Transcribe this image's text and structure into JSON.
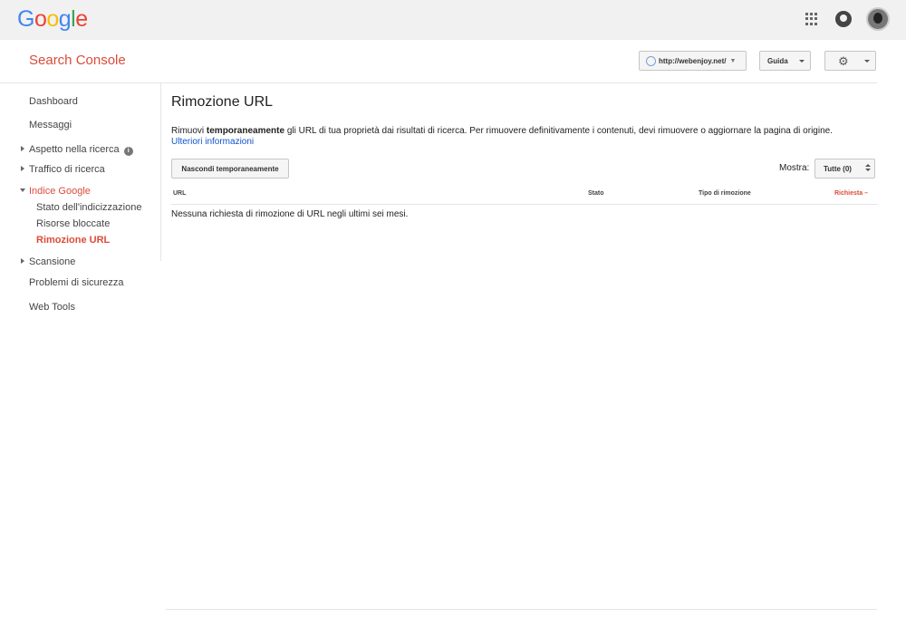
{
  "gbar": {
    "logo_letters": [
      {
        "ch": "G",
        "color": "#4285f4"
      },
      {
        "ch": "o",
        "color": "#ea4335"
      },
      {
        "ch": "o",
        "color": "#fbbc05"
      },
      {
        "ch": "g",
        "color": "#4285f4"
      },
      {
        "ch": "l",
        "color": "#34a853"
      },
      {
        "ch": "e",
        "color": "#ea4335"
      }
    ],
    "icons": [
      "apps-grid-icon",
      "notifications-icon",
      "user-avatar"
    ]
  },
  "header": {
    "title": "Search Console",
    "property": "http://webenjoy.net/",
    "help_label": "Guida",
    "settings_icon": "gear-icon"
  },
  "sidebar": {
    "dashboard": "Dashboard",
    "messages": "Messaggi",
    "appearance": "Aspetto nella ricerca",
    "traffic": "Traffico di ricerca",
    "index": "Indice Google",
    "index_status": "Stato dell'indicizzazione",
    "blocked": "Risorse bloccate",
    "removal": "Rimozione URL",
    "crawl": "Scansione",
    "security": "Problemi di sicurezza",
    "webtools": "Web Tools"
  },
  "main": {
    "title": "Rimozione URL",
    "desc_pre": "Rimuovi ",
    "desc_bold": "temporaneamente",
    "desc_post": " gli URL di tua proprietà dai risultati di ricerca. Per rimuovere definitivamente i contenuti, devi rimuovere o aggiornare la pagina di origine.",
    "more_link": "Ulteriori informazioni",
    "hide_button": "Nascondi temporaneamente",
    "show_label": "Mostra:",
    "show_value": "Tutte (0)",
    "columns": {
      "url": "URL",
      "status": "Stato",
      "type": "Tipo di rimozione",
      "request": "Richiesta"
    },
    "sort_indicator": "–",
    "empty_message": "Nessuna richiesta di rimozione di URL negli ultimi sei mesi."
  },
  "colors": {
    "accent": "#dd4b39",
    "link": "#1155cc",
    "topbar": "#f1f1f1"
  }
}
